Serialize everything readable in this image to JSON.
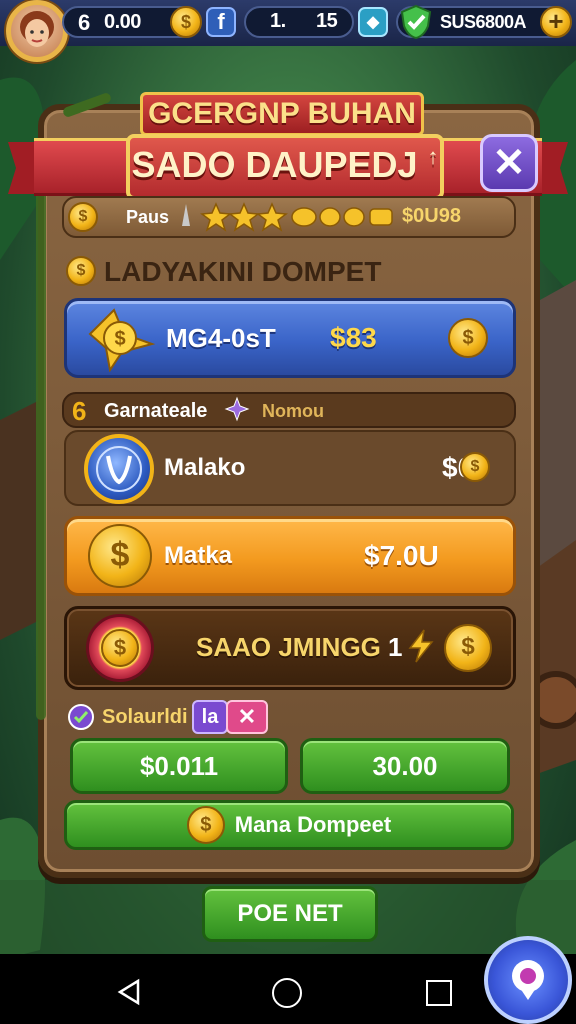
{
  "topbar": {
    "lives": "6",
    "lives_value": "0.00",
    "social_badge": "f",
    "counter_a": "1.",
    "counter_b": "15",
    "currency_total": "SUS6800A",
    "add_symbol": "+"
  },
  "dialog": {
    "title_top": "GCERGNP BUHAN",
    "title_main": "SADO DAUPEDJ",
    "title_mark": "↑",
    "close_symbol": "✕",
    "pass_row": {
      "label": "Paus",
      "value": "$0U98"
    },
    "section_title": "LADYAKINI DOMPET",
    "offer_blue": {
      "name": "MG4-0sT",
      "price": "$83"
    },
    "sub_header": {
      "number": "6",
      "label": "Garnateale",
      "tag": "Nomou"
    },
    "offer_malako": {
      "name": "Malako",
      "price": "$0"
    },
    "offer_matka": {
      "name": "Matka",
      "price": "$7.0U"
    },
    "offer_dark": {
      "name": "SAAO JMINGG",
      "count": "1"
    },
    "bottom_header": {
      "label": "Solaurldi",
      "tag": "la"
    },
    "btn_left": "$0.011",
    "btn_right": "30.00",
    "btn_wide": "Mana Dompeet"
  },
  "footer_button": "POE NET",
  "navbar": {
    "back_icon": "back-triangle",
    "home_icon": "home-circle",
    "recents_icon": "recents-square"
  },
  "colors": {
    "gold": "#f2b418",
    "blue_offer": "#3a64c8",
    "orange_offer": "#f39a1f",
    "green_button": "#2f8f1f",
    "ribbon_red": "#b32b2e",
    "panel_brown": "#6d4e31"
  }
}
